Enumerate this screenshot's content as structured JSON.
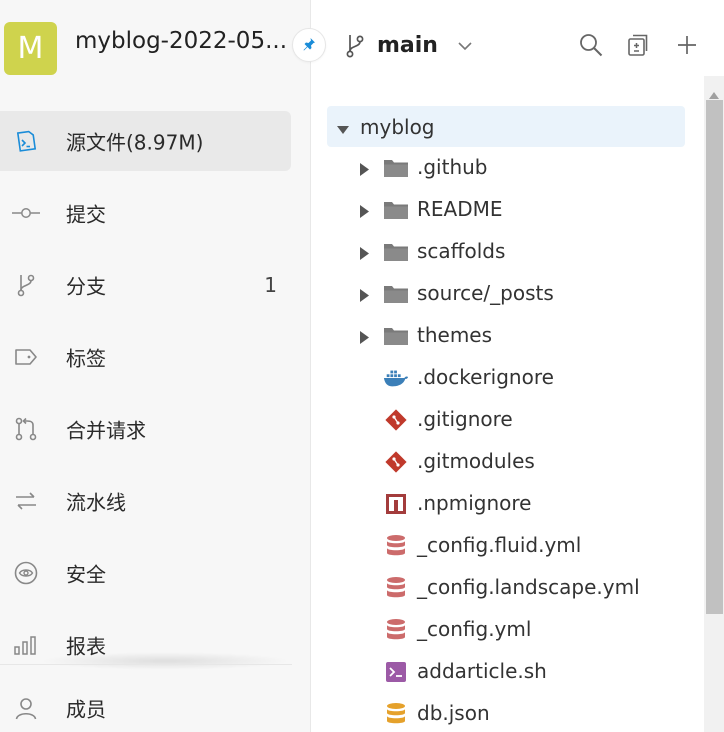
{
  "repo": {
    "avatar_letter": "M",
    "avatar_color": "#cfd34d",
    "name": "myblog-2022-05..."
  },
  "sidebar": {
    "items": [
      {
        "label": "源文件(8.97M)",
        "icon": "code-icon",
        "active": true
      },
      {
        "label": "提交",
        "icon": "commit-icon"
      },
      {
        "label": "分支",
        "icon": "branch-icon",
        "count": "1"
      },
      {
        "label": "标签",
        "icon": "tag-icon"
      },
      {
        "label": "合并请求",
        "icon": "merge-request-icon"
      },
      {
        "label": "流水线",
        "icon": "pipeline-icon"
      },
      {
        "label": "安全",
        "icon": "security-icon"
      },
      {
        "label": "报表",
        "icon": "chart-icon"
      }
    ],
    "member": {
      "label": "成员",
      "icon": "user-icon"
    }
  },
  "branch": {
    "name": "main"
  },
  "tree": {
    "root": "myblog",
    "items": [
      {
        "name": ".github",
        "type": "folder",
        "icon": "folder-icon"
      },
      {
        "name": "README",
        "type": "folder",
        "icon": "folder-icon"
      },
      {
        "name": "scaffolds",
        "type": "folder",
        "icon": "folder-icon"
      },
      {
        "name": "source/_posts",
        "type": "folder",
        "icon": "folder-icon"
      },
      {
        "name": "themes",
        "type": "folder",
        "icon": "folder-icon"
      },
      {
        "name": ".dockerignore",
        "type": "file",
        "icon": "docker-icon"
      },
      {
        "name": ".gitignore",
        "type": "file",
        "icon": "git-icon"
      },
      {
        "name": ".gitmodules",
        "type": "file",
        "icon": "git-icon"
      },
      {
        "name": ".npmignore",
        "type": "file",
        "icon": "npm-icon"
      },
      {
        "name": "_config.fluid.yml",
        "type": "file",
        "icon": "yaml-icon"
      },
      {
        "name": "_config.landscape.yml",
        "type": "file",
        "icon": "yaml-icon"
      },
      {
        "name": "_config.yml",
        "type": "file",
        "icon": "yaml-icon"
      },
      {
        "name": "addarticle.sh",
        "type": "file",
        "icon": "shell-icon"
      },
      {
        "name": "db.json",
        "type": "file",
        "icon": "json-icon"
      }
    ]
  },
  "colors": {
    "active_accent": "#1a8cd8",
    "folder": "#7a7a7a",
    "git": "#c0392b",
    "npm": "#a33c3c",
    "yaml": "#cc6b6b",
    "shell": "#9c5aa6",
    "json": "#e5a12b",
    "docker": "#3b7fb8"
  }
}
